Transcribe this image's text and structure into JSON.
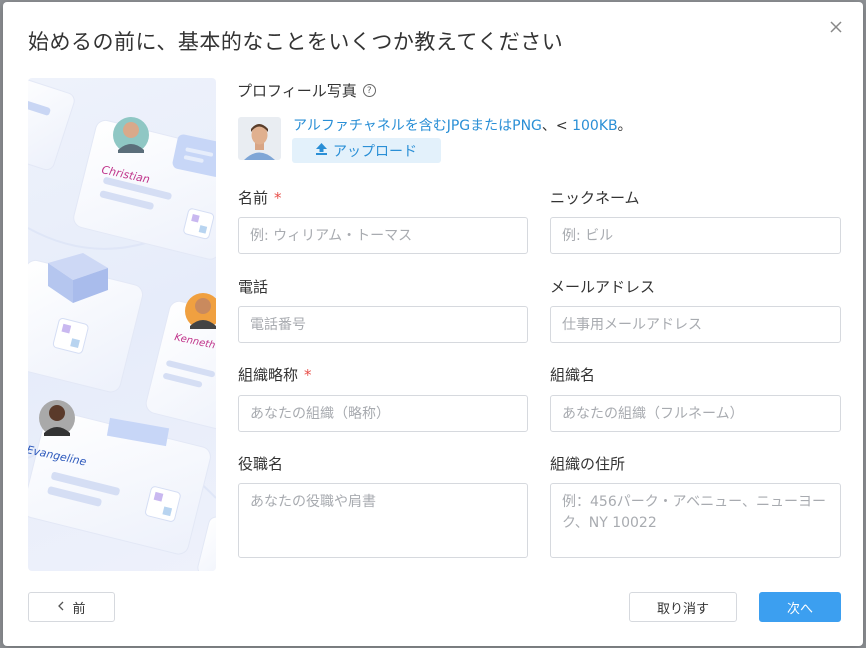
{
  "dialog": {
    "title": "始めるの前に、基本的なことをいくつか教えてください",
    "close_icon": "close-icon"
  },
  "illustration": {
    "names": [
      "Christian",
      "Kenneth",
      "Evangeline"
    ]
  },
  "photo": {
    "label": "プロフィール写真",
    "help_icon": "question-icon",
    "hint_text": "アルファチャネルを含むJPGまたはPNG",
    "hint_sep": "、<",
    "hint_size": "100KB",
    "hint_end": "。",
    "upload_label": "アップロード",
    "upload_icon": "upload-icon"
  },
  "form": {
    "name": {
      "label": "名前",
      "required": "*",
      "placeholder": "例: ウィリアム・トーマス"
    },
    "nickname": {
      "label": "ニックネーム",
      "placeholder": "例: ビル"
    },
    "phone": {
      "label": "電話",
      "placeholder": "電話番号"
    },
    "email": {
      "label": "メールアドレス",
      "placeholder": "仕事用メールアドレス"
    },
    "org_short": {
      "label": "組織略称",
      "required": "*",
      "placeholder": "あなたの組織（略称）"
    },
    "org_name": {
      "label": "組織名",
      "placeholder": "あなたの組織（フルネーム）"
    },
    "job_title": {
      "label": "役職名",
      "placeholder": "あなたの役職や肩書"
    },
    "org_address": {
      "label": "組織の住所",
      "placeholder": "例：456パーク・アベニュー、ニューヨーク、NY 10022"
    }
  },
  "footer": {
    "prev_label": "前",
    "prev_icon": "chevron-left-icon",
    "cancel_label": "取り消す",
    "next_label": "次へ"
  },
  "colors": {
    "accent": "#3c9ff0",
    "link": "#2a8fd6",
    "required": "#e8504a"
  }
}
